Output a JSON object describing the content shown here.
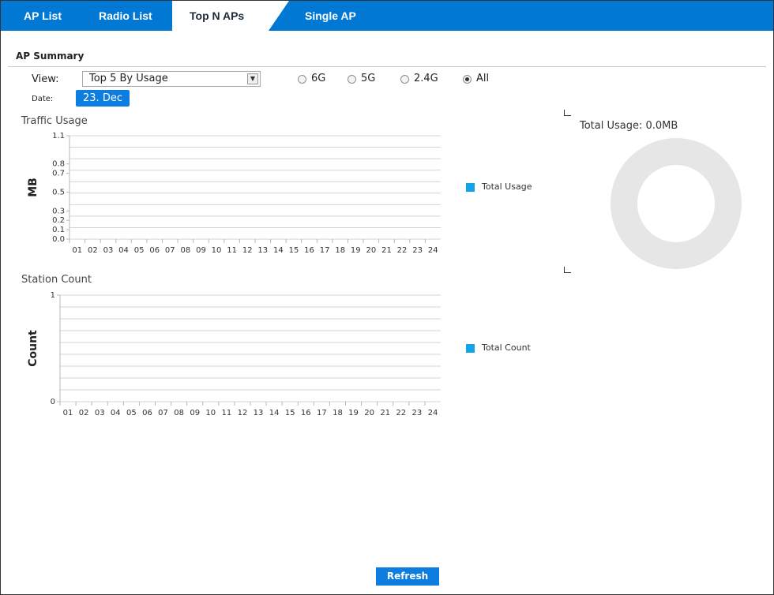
{
  "tabs": [
    {
      "label": "AP List"
    },
    {
      "label": "Radio List"
    },
    {
      "label": "Top N APs",
      "active": true
    },
    {
      "label": "Single AP"
    }
  ],
  "section": {
    "title": "AP Summary"
  },
  "view": {
    "label": "View:",
    "selected": "Top 5 By Usage"
  },
  "bands": [
    {
      "label": "6G",
      "checked": false
    },
    {
      "label": "5G",
      "checked": false
    },
    {
      "label": "2.4G",
      "checked": false
    },
    {
      "label": "All",
      "checked": true
    }
  ],
  "date": {
    "label": "Date:",
    "value": "23. Dec"
  },
  "traffic_chart": {
    "title": "Traffic Usage",
    "legend": "Total Usage"
  },
  "station_chart": {
    "title": "Station Count",
    "legend": "Total Count"
  },
  "donut": {
    "title": "Total Usage: 0.0MB"
  },
  "refresh_label": "Refresh",
  "colors": {
    "tab_bar": "#0078d4",
    "accent": "#0d7de0",
    "legend": "#13a3ea",
    "donut": "#e6e6e6"
  },
  "chart_data": [
    {
      "type": "bar",
      "title": "Traffic Usage",
      "ylabel": "MB",
      "ylim": [
        0,
        1.1
      ],
      "y_ticks": [
        "1.1",
        "0.8",
        "0.7",
        "0.5",
        "0.3",
        "0.2",
        "0.1",
        "0.0"
      ],
      "categories": [
        "01",
        "02",
        "03",
        "04",
        "05",
        "06",
        "07",
        "08",
        "09",
        "10",
        "11",
        "12",
        "13",
        "14",
        "15",
        "16",
        "17",
        "18",
        "19",
        "20",
        "21",
        "22",
        "23",
        "24"
      ],
      "series": [
        {
          "name": "Total Usage",
          "values": [
            0,
            0,
            0,
            0,
            0,
            0,
            0,
            0,
            0,
            0,
            0,
            0,
            0,
            0,
            0,
            0,
            0,
            0,
            0,
            0,
            0,
            0,
            0,
            0
          ]
        }
      ],
      "legend": "right"
    },
    {
      "type": "bar",
      "title": "Station Count",
      "ylabel": "Count",
      "ylim": [
        0,
        1
      ],
      "y_ticks": [
        "1",
        "0"
      ],
      "categories": [
        "01",
        "02",
        "03",
        "04",
        "05",
        "06",
        "07",
        "08",
        "09",
        "10",
        "11",
        "12",
        "13",
        "14",
        "15",
        "16",
        "17",
        "18",
        "19",
        "20",
        "21",
        "22",
        "23",
        "24"
      ],
      "series": [
        {
          "name": "Total Count",
          "values": [
            0,
            0,
            0,
            0,
            0,
            0,
            0,
            0,
            0,
            0,
            0,
            0,
            0,
            0,
            0,
            0,
            0,
            0,
            0,
            0,
            0,
            0,
            0,
            0
          ]
        }
      ],
      "legend": "right"
    },
    {
      "type": "pie",
      "title": "Total Usage: 0.0MB",
      "values": []
    }
  ]
}
